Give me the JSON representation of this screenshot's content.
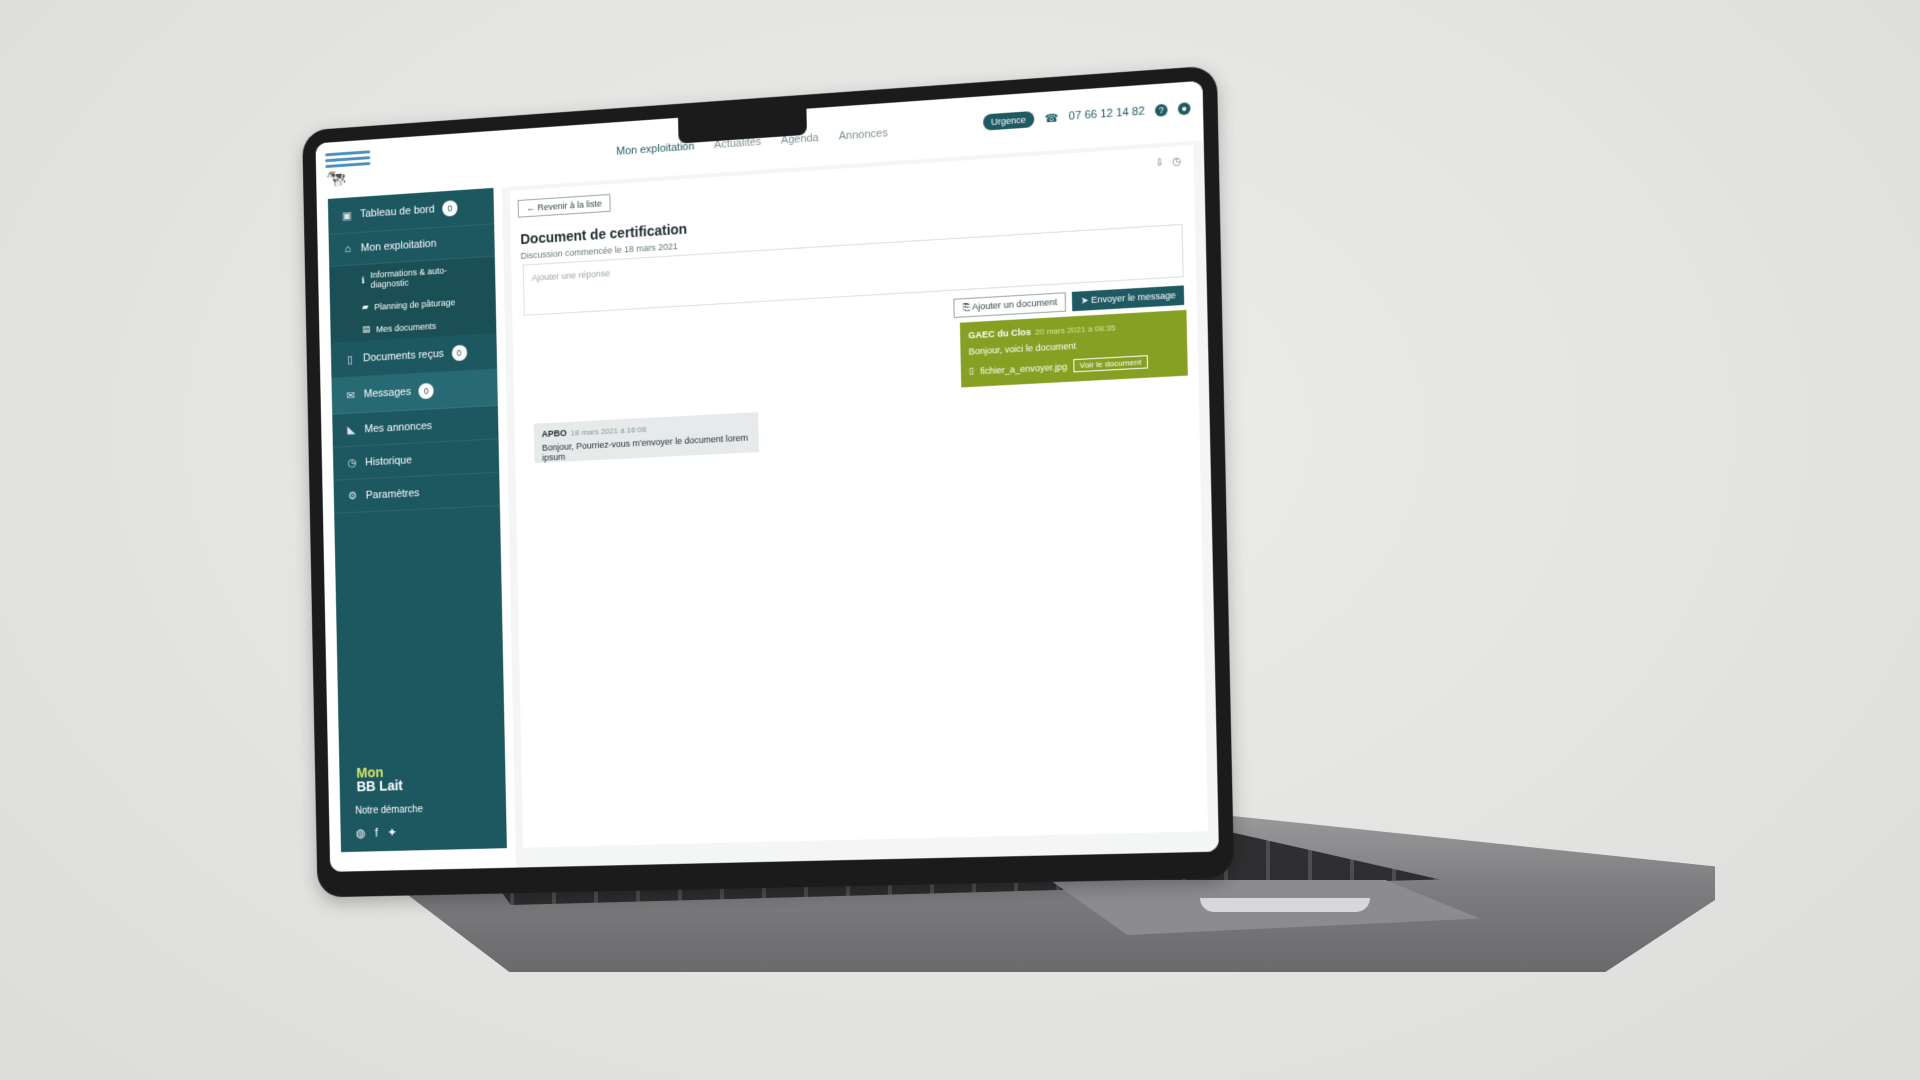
{
  "topbar": {
    "nav": [
      "Mon exploitation",
      "Actualités",
      "Agenda",
      "Annonces"
    ],
    "urgence": "Urgence",
    "phone": "07 66 12 14 82",
    "help_icon": "question-circle-icon",
    "user_icon": "user-circle-icon"
  },
  "sidebar": {
    "items": [
      {
        "label": "Tableau de bord",
        "count": "0",
        "icon": "dashboard-icon"
      },
      {
        "label": "Mon exploitation",
        "icon": "farm-icon"
      },
      {
        "label": "Documents reçus",
        "count": "0",
        "icon": "document-icon"
      },
      {
        "label": "Messages",
        "count": "0",
        "icon": "mail-icon"
      },
      {
        "label": "Mes annonces",
        "icon": "megaphone-icon"
      },
      {
        "label": "Historique",
        "icon": "clock-icon"
      },
      {
        "label": "Paramètres",
        "icon": "gear-icon"
      }
    ],
    "subitems": [
      {
        "label": "Informations & auto-diagnostic",
        "icon": "info-icon"
      },
      {
        "label": "Planning de pâturage",
        "icon": "cow-icon"
      },
      {
        "label": "Mes documents",
        "icon": "image-icon"
      }
    ],
    "brand": {
      "line1": "Mon",
      "line2": "BB Lait"
    },
    "brand_text": "Notre démarche"
  },
  "main": {
    "back": "Revenir à la liste",
    "title": "Document de certification",
    "subtitle": "Discussion commencée le 18 mars 2021",
    "reply_placeholder": "Ajouter une réponse",
    "add_doc": "Ajouter un document",
    "send": "Envoyer le message",
    "messages": [
      {
        "author": "GAEC du Clos",
        "time": "20 mars 2021 à 08:35",
        "text": "Bonjour, voici le document",
        "file": "fichier_a_envoyer.jpg",
        "view": "Voir le document"
      },
      {
        "author": "APBO",
        "time": "18 mars 2021 à 16:08",
        "text": "Bonjour, Pourriez-vous m'envoyer le document lorem ipsum"
      }
    ]
  },
  "colors": {
    "primary": "#1f5a63",
    "sidebar": "#1d5860",
    "accent_green": "#86a023",
    "background": "#e6e6e4"
  }
}
